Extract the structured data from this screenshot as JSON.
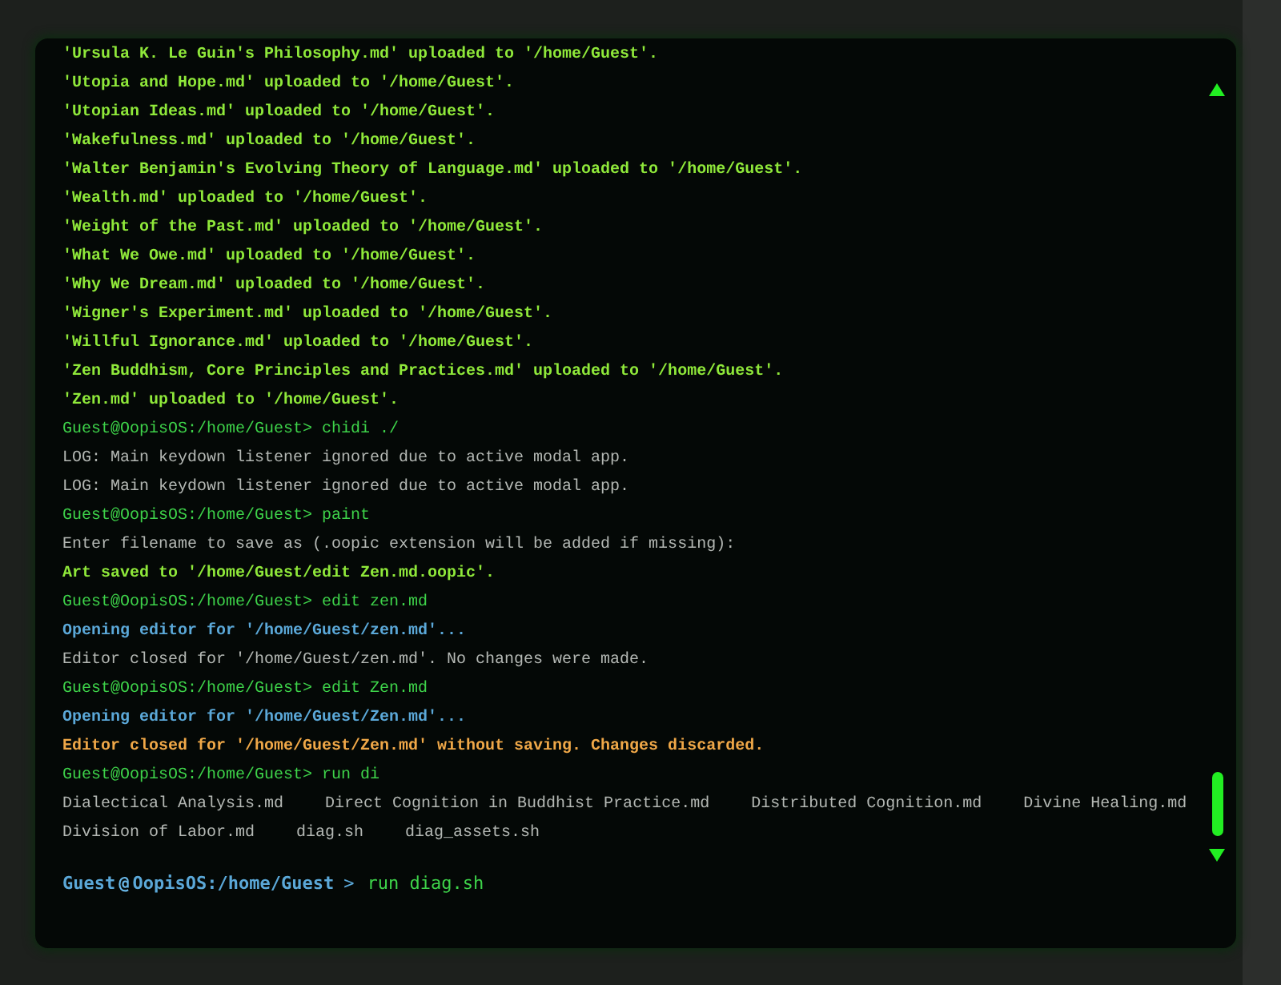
{
  "terminal": {
    "output": [
      {
        "kind": "upload",
        "text": "'Ursula K. Le Guin's Philosophy.md' uploaded to '/home/Guest'."
      },
      {
        "kind": "upload",
        "text": "'Utopia and Hope.md' uploaded to '/home/Guest'."
      },
      {
        "kind": "upload",
        "text": "'Utopian Ideas.md' uploaded to '/home/Guest'."
      },
      {
        "kind": "upload",
        "text": "'Wakefulness.md' uploaded to '/home/Guest'."
      },
      {
        "kind": "upload",
        "text": "'Walter Benjamin's Evolving Theory of Language.md' uploaded to '/home/Guest'."
      },
      {
        "kind": "upload",
        "text": "'Wealth.md' uploaded to '/home/Guest'."
      },
      {
        "kind": "upload",
        "text": "'Weight of the Past.md' uploaded to '/home/Guest'."
      },
      {
        "kind": "upload",
        "text": "'What We Owe.md' uploaded to '/home/Guest'."
      },
      {
        "kind": "upload",
        "text": "'Why We Dream.md' uploaded to '/home/Guest'."
      },
      {
        "kind": "upload",
        "text": "'Wigner's Experiment.md' uploaded to '/home/Guest'."
      },
      {
        "kind": "upload",
        "text": "'Willful Ignorance.md' uploaded to '/home/Guest'."
      },
      {
        "kind": "upload",
        "text": "'Zen Buddhism, Core Principles and Practices.md' uploaded to '/home/Guest'."
      },
      {
        "kind": "upload",
        "text": "'Zen.md' uploaded to '/home/Guest'."
      },
      {
        "kind": "prompt",
        "text": "Guest@OopisOS:/home/Guest> chidi ./"
      },
      {
        "kind": "log",
        "text": "LOG: Main keydown listener ignored due to active modal app."
      },
      {
        "kind": "log",
        "text": "LOG: Main keydown listener ignored due to active modal app."
      },
      {
        "kind": "prompt",
        "text": "Guest@OopisOS:/home/Guest> paint"
      },
      {
        "kind": "log",
        "text": "Enter filename to save as (.oopic extension will be added if missing):"
      },
      {
        "kind": "success",
        "text": "Art saved to '/home/Guest/edit Zen.md.oopic'."
      },
      {
        "kind": "prompt",
        "text": "Guest@OopisOS:/home/Guest> edit zen.md"
      },
      {
        "kind": "info",
        "text": "Opening editor for '/home/Guest/zen.md'..."
      },
      {
        "kind": "log",
        "text": "Editor closed for '/home/Guest/zen.md'. No changes were made."
      },
      {
        "kind": "prompt",
        "text": "Guest@OopisOS:/home/Guest> edit Zen.md"
      },
      {
        "kind": "info",
        "text": "Opening editor for '/home/Guest/Zen.md'..."
      },
      {
        "kind": "warning",
        "text": "Editor closed for '/home/Guest/Zen.md' without saving. Changes discarded."
      },
      {
        "kind": "prompt",
        "text": "Guest@OopisOS:/home/Guest> run di"
      },
      {
        "kind": "listing",
        "items": [
          "Dialectical Analysis.md",
          "Direct Cognition in Buddhist Practice.md",
          "Distributed Cognition.md",
          "Divine Healing.md"
        ]
      },
      {
        "kind": "listing",
        "items": [
          "Division of Labor.md",
          "diag.sh",
          "diag_assets.sh"
        ]
      }
    ],
    "input": {
      "user": "Guest",
      "at": "@",
      "host": "OopisOS",
      "path": ":/home/Guest",
      "caret": ">",
      "value": "run diag.sh"
    }
  }
}
